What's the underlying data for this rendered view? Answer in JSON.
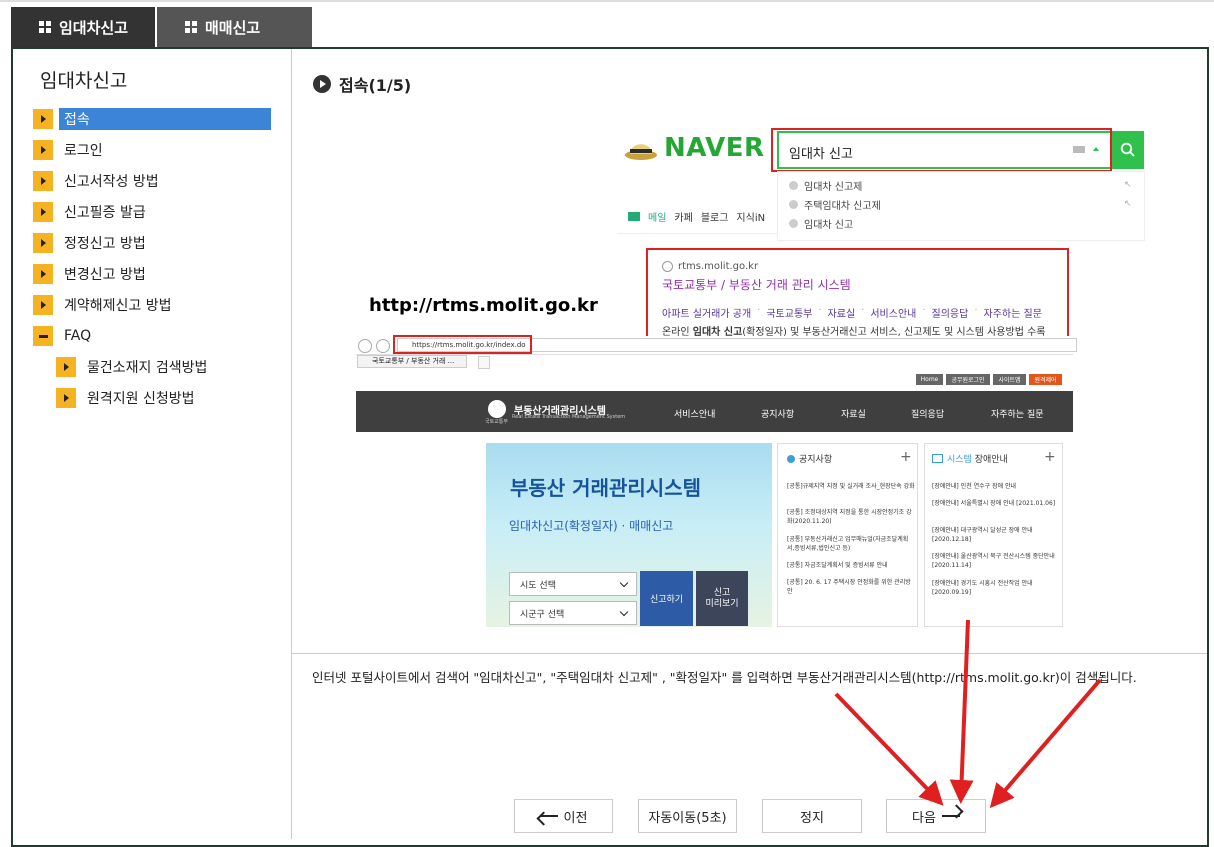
{
  "tabs": [
    {
      "label": "임대차신고"
    },
    {
      "label": "매매신고"
    }
  ],
  "sidebar": {
    "title": "임대차신고",
    "items": [
      {
        "label": "접속"
      },
      {
        "label": "로그인"
      },
      {
        "label": "신고서작성 방법"
      },
      {
        "label": "신고필증 발급"
      },
      {
        "label": "정정신고 방법"
      },
      {
        "label": "변경신고 방법"
      },
      {
        "label": "계약해제신고 방법"
      },
      {
        "label": "FAQ"
      }
    ],
    "subitems": [
      {
        "label": "물건소재지 검색방법"
      },
      {
        "label": "원격지원 신청방법"
      }
    ]
  },
  "content": {
    "title": "접속(1/5)",
    "description": "인터넷 포털사이트에서 검색어 \"임대차신고\", \"주택임대차 신고제\" , \"확정일자\" 를 입력하면 부동산거래관리시스템(http://rtms.molit.go.kr)이 검색됩니다.",
    "url_caption": "http://rtms.molit.go.kr"
  },
  "screenshot": {
    "naver": {
      "logo": "NAVER",
      "query": "임대차 신고",
      "suggestions": [
        "임대차 신고제",
        "주택임대차 신고제",
        "임대차 신고"
      ],
      "menu": [
        "메일",
        "카페",
        "블로그",
        "지식iN"
      ]
    },
    "result": {
      "url": "rtms.molit.go.kr",
      "title": "국토교통부 / 부동산 거래 관리 시스템",
      "links": [
        "아파트 실거래가 공개",
        "국토교통부",
        "자료실",
        "서비스안내",
        "질의응답",
        "자주하는 질문"
      ],
      "desc_prefix": "온라인 ",
      "desc_bold": "임대차 신고",
      "desc_suffix": "(확정일자) 및 부동산거래신고 서비스, 신고제도 및 시스템 사용방법 수록"
    },
    "browser": {
      "address": "https://rtms.molit.go.kr/index.do",
      "tab": "국토교통부 / 부동산 거래 ...",
      "utils": [
        "Home",
        "공무원로그인",
        "사이트맵",
        "원격제어"
      ]
    },
    "site": {
      "logo": "부동산거래관리시스템",
      "org": "국토교통부",
      "subtitle": "Real Estate Transaction Management System",
      "nav": [
        "서비스안내",
        "공지사항",
        "자료실",
        "질의응답",
        "자주하는 질문"
      ],
      "hero_title": "부동산 거래관리시스템",
      "hero_sub": "임대차신고(확정일자) · 매매신고",
      "select1": "시도 선택",
      "select2": "시군구 선택",
      "btn_report": "신고하기",
      "btn_preview_1": "신고",
      "btn_preview_2": "미리보기",
      "notice_title": "공지사항",
      "notices": [
        "[공통]규제지역 지정 및 실거래 조사_현장단속 강화",
        "[공통] 조정대상지역 지정을 통한 시장안정기조 강화(2020.11.20)",
        "[공통] 부동산거래신고 업무매뉴얼(자금조달계획서,증빙서류,법인신고 등)",
        "[공통] 자금조달계획서 및 증빙서류 안내",
        "[공통] 20. 6. 17 주택시장 안정화를 위한 관리방안"
      ],
      "outage_title_1": "시스템",
      "outage_title_2": "장애안내",
      "outages": [
        "[장애안내] 인천 연수구 장애 안내",
        "[장애안내] 서울특별시 장애 안내 [2021.01.06]",
        "[장애안내] 대구광역시 달성군 장애 안내 [2020.12.18]",
        "[장애안내] 울산광역시 북구 전산시스템 중단안내 [2020.11.14]",
        "[장애안내] 경기도 시흥시 전산작업 안내 [2020.09.19]"
      ]
    }
  },
  "buttons": {
    "prev": "이전",
    "auto": "자동이동(5초)",
    "stop": "정지",
    "next": "다음"
  },
  "colors": {
    "accent": "#f5b323",
    "active": "#3b84d8",
    "annotation": "#dd2222"
  }
}
